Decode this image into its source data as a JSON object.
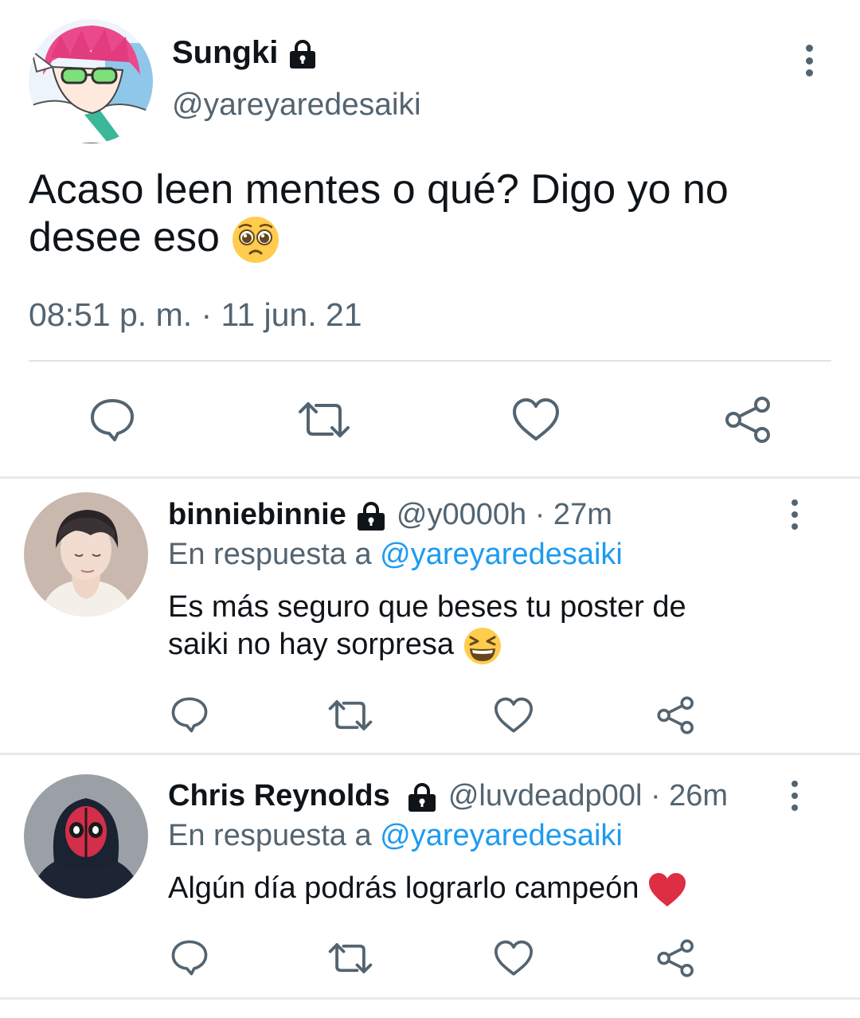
{
  "main_tweet": {
    "author": {
      "name": "Sungki",
      "handle": "@yareyaredesaiki",
      "locked": true
    },
    "text": "Acaso leen mentes o qué? Digo yo no desee eso",
    "emoji": "pleading-face",
    "timestamp": "08:51 p. m. · 11 jun. 21",
    "actions": [
      "reply-icon",
      "retweet-icon",
      "like-icon",
      "share-icon"
    ]
  },
  "replies": [
    {
      "name": "binniebinnie",
      "handle": "@y0000h",
      "time": "· 27m",
      "locked": true,
      "reply_prefix": "En respuesta a",
      "reply_mention": "@yareyaredesaiki",
      "text_line1": "Es más seguro que beses tu poster de",
      "text_line2": "saiki no hay sorpresa",
      "emoji": "grinning-squinting-face"
    },
    {
      "name": "Chris Reynolds",
      "handle": "@luvdeadp00l",
      "time": "· 26m",
      "locked": true,
      "reply_prefix": "En respuesta a",
      "reply_mention": "@yareyaredesaiki",
      "text_line1": "Algún día podrás lograrlo campeón",
      "emoji": "red-heart"
    }
  ],
  "colors": {
    "text": "#0f1419",
    "secondary": "#536471",
    "mention": "#1d9bf0",
    "divider": "#e7eaed"
  }
}
